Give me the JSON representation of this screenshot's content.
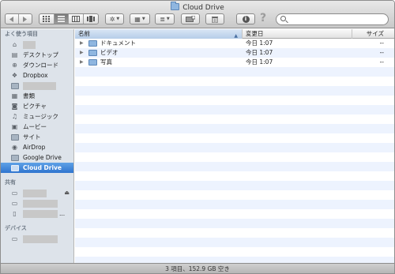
{
  "window": {
    "title": "Cloud Drive"
  },
  "toolbar": {
    "back_icon": "back-arrow",
    "forward_icon": "forward-arrow",
    "view_icons": "icon-view",
    "view_list": "list-view",
    "view_columns": "column-view",
    "view_coverflow": "coverflow-view",
    "action_glyph": "✲",
    "arrange_glyph": "▦",
    "share_glyph": "≣",
    "newfolder_glyph": "⊕",
    "trash_glyph": "🗑",
    "info_glyph": "i",
    "help_glyph": "?",
    "search_placeholder": ""
  },
  "sidebar": {
    "favorites_header": "よく使う項目",
    "favorites": [
      {
        "label": "",
        "icon": "home-icon",
        "redacted": true
      },
      {
        "label": "デスクトップ",
        "icon": "desktop-icon"
      },
      {
        "label": "ダウンロード",
        "icon": "downloads-icon"
      },
      {
        "label": "Dropbox",
        "icon": "dropbox-icon"
      },
      {
        "label": "",
        "icon": "folder-icon",
        "redacted": true
      },
      {
        "label": "書類",
        "icon": "documents-icon"
      },
      {
        "label": "ピクチャ",
        "icon": "pictures-icon"
      },
      {
        "label": "ミュージック",
        "icon": "music-icon"
      },
      {
        "label": "ムービー",
        "icon": "movies-icon"
      },
      {
        "label": "サイト",
        "icon": "sites-icon"
      },
      {
        "label": "AirDrop",
        "icon": "airdrop-icon"
      },
      {
        "label": "Google Drive",
        "icon": "folder-icon"
      },
      {
        "label": "Cloud Drive",
        "icon": "folder-icon",
        "selected": true
      }
    ],
    "shared_header": "共有",
    "shared": [
      {
        "label": "",
        "icon": "monitor-icon",
        "eject": "⏏"
      },
      {
        "label": "",
        "icon": "monitor-icon"
      },
      {
        "label": "...",
        "icon": "server-icon"
      }
    ],
    "devices_header": "デバイス",
    "devices": [
      {
        "label": "",
        "icon": "monitor-icon"
      }
    ]
  },
  "columns": {
    "name": "名前",
    "date": "変更日",
    "size": "サイズ"
  },
  "files": [
    {
      "name": "ドキュメント",
      "date": "今日 1:07",
      "size": "--"
    },
    {
      "name": "ビデオ",
      "date": "今日 1:07",
      "size": "--"
    },
    {
      "name": "写真",
      "date": "今日 1:07",
      "size": "--"
    }
  ],
  "status": "3 項目、152.9 GB 空き"
}
